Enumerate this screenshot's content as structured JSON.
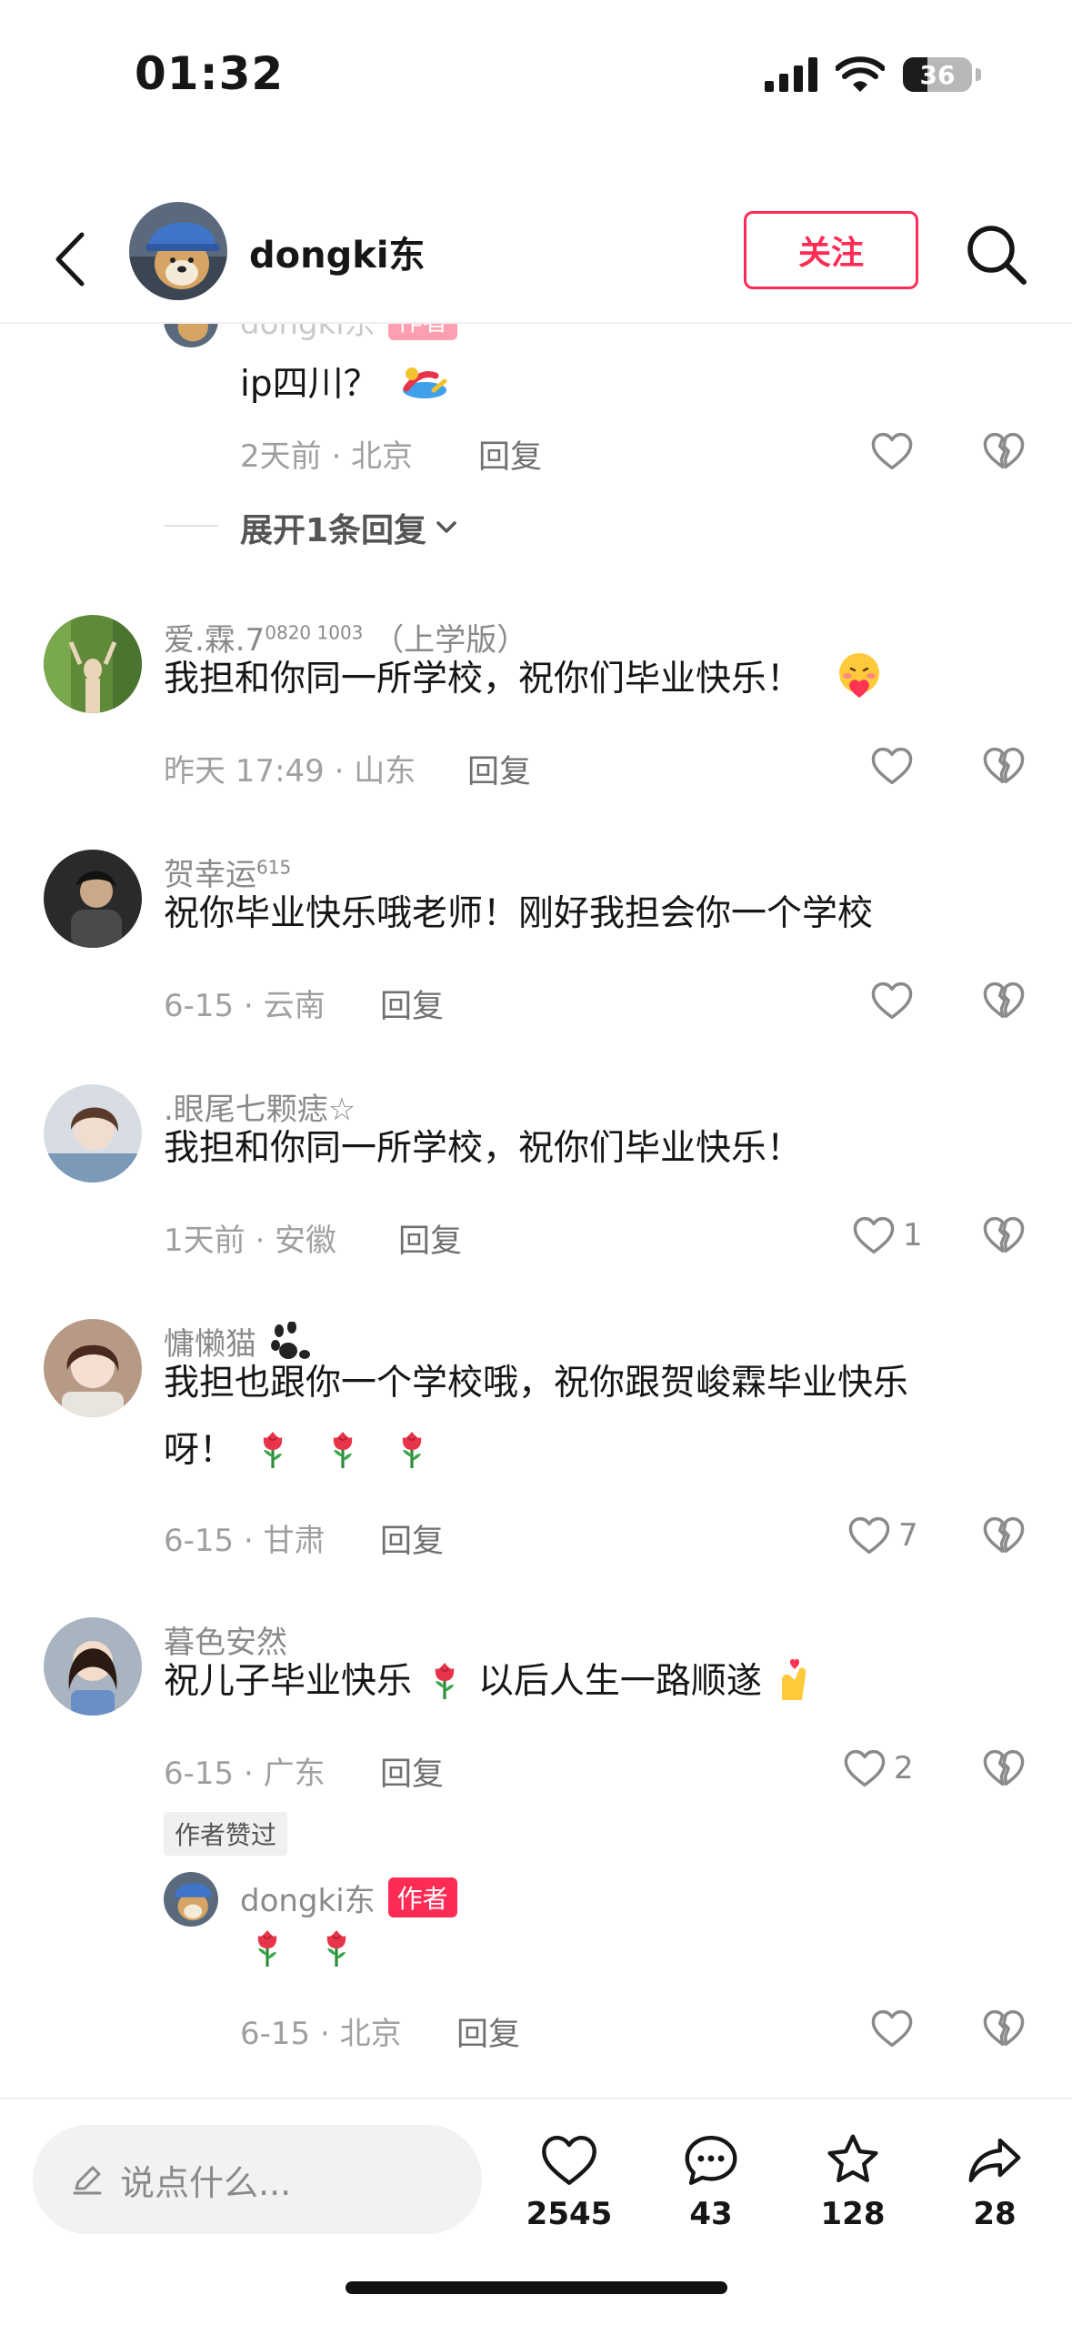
{
  "status_bar": {
    "time": "01:32",
    "battery": "36",
    "battery_level": 0.36
  },
  "header": {
    "username": "dongki东",
    "follow_label": "关注"
  },
  "comments": [
    {
      "username": "dongki东",
      "author_badge": "作者",
      "text": "ip四川？",
      "meta": "2天前 · 北京",
      "reply_label": "回复",
      "likes": "",
      "expand_label": "展开1条回复"
    },
    {
      "username": "爱.霖.7",
      "username_sup": "0820 1003",
      "username_suffix": "（上学版）",
      "text": "我担和你同一所学校，祝你们毕业快乐！",
      "meta": "昨天 17:49 · 山东",
      "reply_label": "回复",
      "likes": ""
    },
    {
      "username": "贺幸运",
      "username_sup": "615",
      "text": "祝你毕业快乐哦老师！刚好我担会你一个学校",
      "meta": "6-15 · 云南",
      "reply_label": "回复",
      "likes": ""
    },
    {
      "username": ".眼尾七颗痣☆",
      "text": "我担和你同一所学校，祝你们毕业快乐！",
      "meta": "1天前 · 安徽",
      "reply_label": "回复",
      "likes": "1"
    },
    {
      "username": "慵懒猫",
      "text_line1": "我担也跟你一个学校哦，祝你跟贺峻霖毕业快乐",
      "text_line2": "呀！",
      "meta": "6-15 · 甘肃",
      "reply_label": "回复",
      "likes": "7"
    },
    {
      "username": "暮色安然",
      "text_part1": "祝儿子毕业快乐",
      "text_part2": "以后人生一路顺遂",
      "meta": "6-15 · 广东",
      "reply_label": "回复",
      "likes": "2",
      "liked_by_author": "作者赞过"
    },
    {
      "username": "dongki东",
      "author_badge": "作者",
      "meta": "6-15 · 北京",
      "reply_label": "回复",
      "likes": ""
    }
  ],
  "bottom_bar": {
    "input_placeholder": "说点什么...",
    "likes": "2545",
    "comments": "43",
    "favorites": "128",
    "shares": "28"
  },
  "icons": [
    "back-icon",
    "search-icon",
    "heart-icon",
    "broken-heart-icon",
    "chevron-down-icon",
    "pencil-icon",
    "comment-icon",
    "star-icon",
    "share-icon",
    "rose-emoji",
    "heart-hands-emoji",
    "swimmer-emoji"
  ],
  "colors": {
    "accent": "#fe2c55",
    "text": "#161616",
    "muted": "#8a8a8a"
  }
}
